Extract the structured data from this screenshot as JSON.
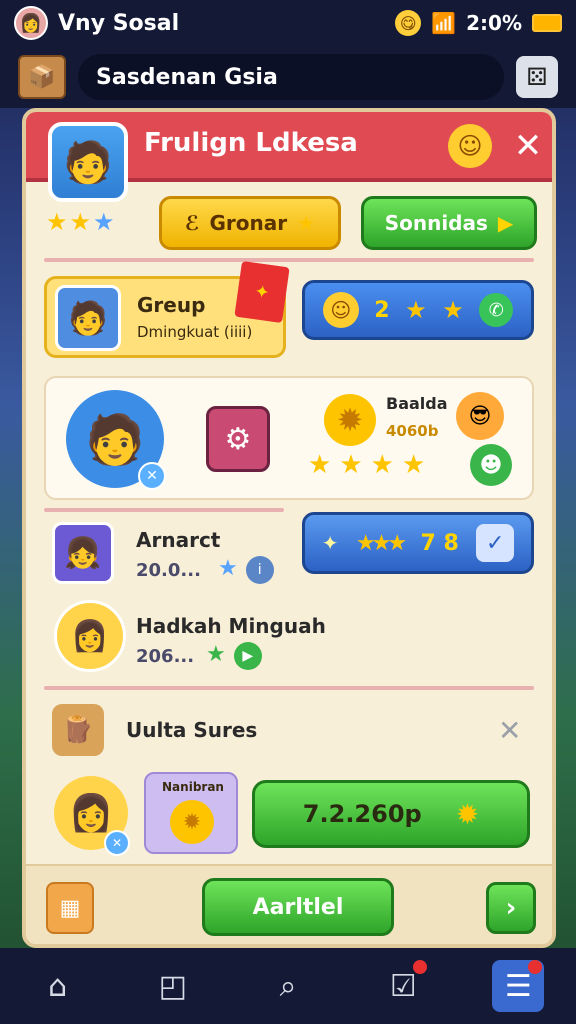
{
  "status": {
    "app_name": "Vny Sosal",
    "battery_text": "2:0%",
    "emoji": "😋"
  },
  "search": {
    "value": "Sasdenan Gsia"
  },
  "panel": {
    "title": "Frulign Ldkesa",
    "buttons": {
      "yellow_label": "Gronar",
      "green_label": "Sonnidas"
    },
    "group": {
      "name": "Greup",
      "sub": "Dmingkuat (iiii)"
    },
    "stats_pill": {
      "count": "2"
    },
    "feature": {
      "label": "Baalda",
      "value": "4060b"
    },
    "row1": {
      "title": "Arnarct",
      "value": "20.0..."
    },
    "rate_pill": {
      "numbers": "7  8"
    },
    "row2": {
      "title": "Hadkah Minguah",
      "value": "206..."
    },
    "section": {
      "title": "Uulta Sures"
    },
    "bottom": {
      "card_label": "Nanibran",
      "price": "7.2.260p"
    },
    "footer": {
      "button_label": "Aarltlel"
    }
  }
}
